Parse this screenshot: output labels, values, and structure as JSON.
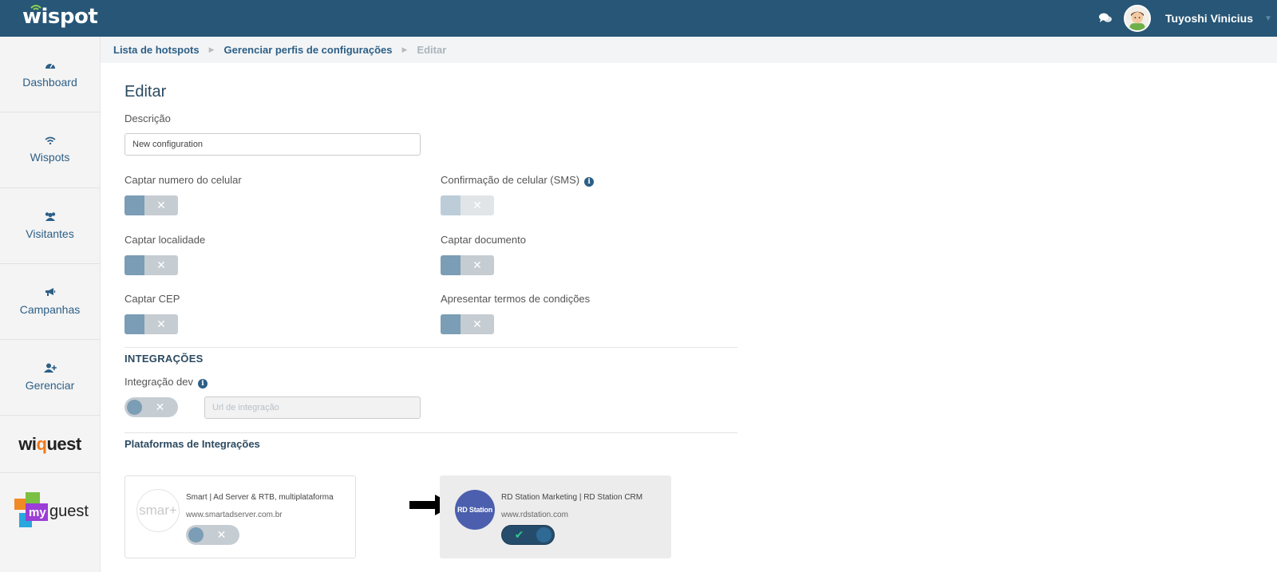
{
  "app": {
    "brand": "wispot"
  },
  "topbar": {
    "user_name": "Tuyoshi Vinicius"
  },
  "sidebar": {
    "items": [
      {
        "label": "Dashboard",
        "icon": "dashboard-icon"
      },
      {
        "label": "Wispots",
        "icon": "wifi-icon"
      },
      {
        "label": "Visitantes",
        "icon": "users-icon"
      },
      {
        "label": "Campanhas",
        "icon": "megaphone-icon"
      },
      {
        "label": "Gerenciar",
        "icon": "user-plus-icon"
      }
    ],
    "brands": {
      "wiquest_a": "wi",
      "wiquest_b": "q",
      "wiquest_c": "uest",
      "myguest_a": "my",
      "myguest_b": "guest"
    }
  },
  "breadcrumb": [
    "Lista de hotspots",
    "Gerenciar perfis de configurações",
    "Editar"
  ],
  "form": {
    "title": "Editar",
    "descricao_label": "Descrição",
    "descricao_value": "New configuration",
    "toggles": {
      "captar_celular": "Captar numero do celular",
      "confirmacao_sms": "Confirmação de celular (SMS)",
      "captar_localidade": "Captar localidade",
      "captar_documento": "Captar documento",
      "captar_cep": "Captar CEP",
      "termos": "Apresentar termos de condições"
    },
    "off_symbol": "✕",
    "on_symbol": "✔"
  },
  "integracoes": {
    "title": "INTEGRAÇÕES",
    "dev_label": "Integração dev",
    "url_placeholder": "Url de integração",
    "platforms_title": "Plataformas de Integrações",
    "platforms": [
      {
        "logo_text": "smar+",
        "name": "Smart | Ad Server & RTB, multiplataforma",
        "url": "www.smartadserver.com.br",
        "enabled": false
      },
      {
        "logo_text": "RD Station",
        "name": "RD Station Marketing | RD Station CRM",
        "url": "www.rdstation.com",
        "enabled": true
      }
    ]
  },
  "colors": {
    "topbar": "#275677",
    "accent": "#2c5f86",
    "toggle_knob": "#7b9db5",
    "toggle_on": "#264c6b",
    "check": "#31c48d"
  }
}
